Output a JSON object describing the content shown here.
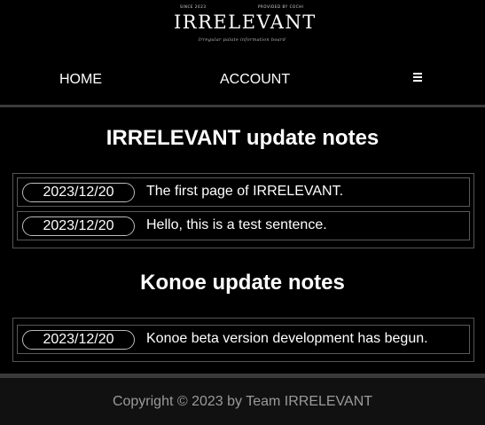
{
  "header": {
    "since": "SINCE 2023",
    "provided_by": "PROVIDED BY COCHI",
    "title": "IRRELEVANT",
    "subtitle": "Irregular palate information board"
  },
  "nav": {
    "home": "HOME",
    "account": "ACCOUNT",
    "menu_icon": "hamburger-icon"
  },
  "sections": [
    {
      "title": "IRRELEVANT update notes",
      "notes": [
        {
          "date": "2023/12/20",
          "text": "The first page of IRRELEVANT."
        },
        {
          "date": "2023/12/20",
          "text": "Hello, this is a test sentence."
        }
      ]
    },
    {
      "title": "Konoe update notes",
      "notes": [
        {
          "date": "2023/12/20",
          "text": "Konoe beta version development has begun."
        }
      ]
    }
  ],
  "footer": {
    "copyright": "Copyright © 2023 by Team IRRELEVANT"
  },
  "colors": {
    "background": "#000000",
    "divider": "#3a3a3a",
    "footer_bg": "#111111",
    "footer_text": "#9a9a9a"
  }
}
